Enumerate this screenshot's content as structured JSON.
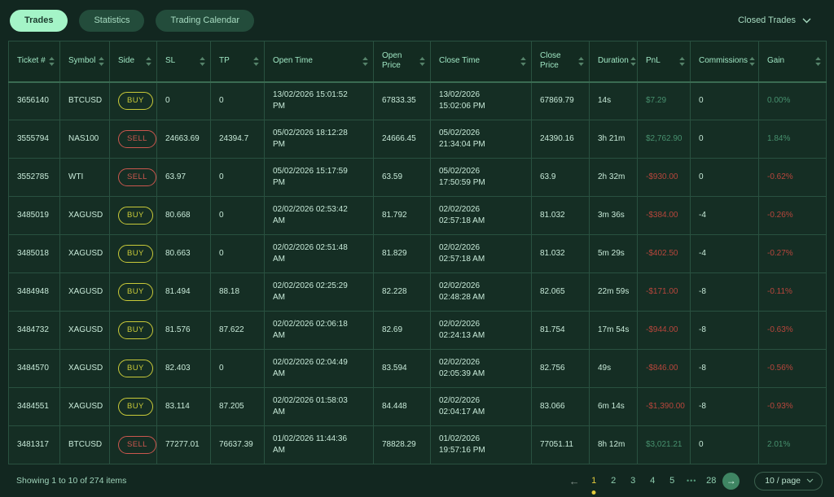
{
  "tabs": [
    {
      "label": "Trades",
      "active": true
    },
    {
      "label": "Statistics",
      "active": false
    },
    {
      "label": "Trading Calendar",
      "active": false
    }
  ],
  "filter": {
    "label": "Closed Trades"
  },
  "table": {
    "columns": [
      {
        "key": "ticket",
        "label": "Ticket #"
      },
      {
        "key": "symbol",
        "label": "Symbol"
      },
      {
        "key": "side",
        "label": "Side"
      },
      {
        "key": "sl",
        "label": "SL"
      },
      {
        "key": "tp",
        "label": "TP"
      },
      {
        "key": "open_time",
        "label": "Open Time"
      },
      {
        "key": "open_price",
        "label": "Open Price"
      },
      {
        "key": "close_time",
        "label": "Close Time"
      },
      {
        "key": "close_price",
        "label": "Close Price"
      },
      {
        "key": "duration",
        "label": "Duration"
      },
      {
        "key": "pnl",
        "label": "PnL"
      },
      {
        "key": "commissions",
        "label": "Commissions"
      },
      {
        "key": "gain",
        "label": "Gain"
      }
    ],
    "rows": [
      {
        "ticket": "3656140",
        "symbol": "BTCUSD",
        "side": "BUY",
        "sl": "0",
        "tp": "0",
        "open_time": "13/02/2026 15:01:52 PM",
        "open_price": "67833.35",
        "close_time": "13/02/2026 15:02:06 PM",
        "close_price": "67869.79",
        "duration": "14s",
        "pnl": "$7.29",
        "commissions": "0",
        "gain": "0.00%"
      },
      {
        "ticket": "3555794",
        "symbol": "NAS100",
        "side": "SELL",
        "sl": "24663.69",
        "tp": "24394.7",
        "open_time": "05/02/2026 18:12:28 PM",
        "open_price": "24666.45",
        "close_time": "05/02/2026 21:34:04 PM",
        "close_price": "24390.16",
        "duration": "3h 21m",
        "pnl": "$2,762.90",
        "commissions": "0",
        "gain": "1.84%"
      },
      {
        "ticket": "3552785",
        "symbol": "WTI",
        "side": "SELL",
        "sl": "63.97",
        "tp": "0",
        "open_time": "05/02/2026 15:17:59 PM",
        "open_price": "63.59",
        "close_time": "05/02/2026 17:50:59 PM",
        "close_price": "63.9",
        "duration": "2h 32m",
        "pnl": "-$930.00",
        "commissions": "0",
        "gain": "-0.62%"
      },
      {
        "ticket": "3485019",
        "symbol": "XAGUSD",
        "side": "BUY",
        "sl": "80.668",
        "tp": "0",
        "open_time": "02/02/2026 02:53:42 AM",
        "open_price": "81.792",
        "close_time": "02/02/2026 02:57:18 AM",
        "close_price": "81.032",
        "duration": "3m 36s",
        "pnl": "-$384.00",
        "commissions": "-4",
        "gain": "-0.26%"
      },
      {
        "ticket": "3485018",
        "symbol": "XAGUSD",
        "side": "BUY",
        "sl": "80.663",
        "tp": "0",
        "open_time": "02/02/2026 02:51:48 AM",
        "open_price": "81.829",
        "close_time": "02/02/2026 02:57:18 AM",
        "close_price": "81.032",
        "duration": "5m 29s",
        "pnl": "-$402.50",
        "commissions": "-4",
        "gain": "-0.27%"
      },
      {
        "ticket": "3484948",
        "symbol": "XAGUSD",
        "side": "BUY",
        "sl": "81.494",
        "tp": "88.18",
        "open_time": "02/02/2026 02:25:29 AM",
        "open_price": "82.228",
        "close_time": "02/02/2026 02:48:28 AM",
        "close_price": "82.065",
        "duration": "22m 59s",
        "pnl": "-$171.00",
        "commissions": "-8",
        "gain": "-0.11%"
      },
      {
        "ticket": "3484732",
        "symbol": "XAGUSD",
        "side": "BUY",
        "sl": "81.576",
        "tp": "87.622",
        "open_time": "02/02/2026 02:06:18 AM",
        "open_price": "82.69",
        "close_time": "02/02/2026 02:24:13 AM",
        "close_price": "81.754",
        "duration": "17m 54s",
        "pnl": "-$944.00",
        "commissions": "-8",
        "gain": "-0.63%"
      },
      {
        "ticket": "3484570",
        "symbol": "XAGUSD",
        "side": "BUY",
        "sl": "82.403",
        "tp": "0",
        "open_time": "02/02/2026 02:04:49 AM",
        "open_price": "83.594",
        "close_time": "02/02/2026 02:05:39 AM",
        "close_price": "82.756",
        "duration": "49s",
        "pnl": "-$846.00",
        "commissions": "-8",
        "gain": "-0.56%"
      },
      {
        "ticket": "3484551",
        "symbol": "XAGUSD",
        "side": "BUY",
        "sl": "83.114",
        "tp": "87.205",
        "open_time": "02/02/2026 01:58:03 AM",
        "open_price": "84.448",
        "close_time": "02/02/2026 02:04:17 AM",
        "close_price": "83.066",
        "duration": "6m 14s",
        "pnl": "-$1,390.00",
        "commissions": "-8",
        "gain": "-0.93%"
      },
      {
        "ticket": "3481317",
        "symbol": "BTCUSD",
        "side": "SELL",
        "sl": "77277.01",
        "tp": "76637.39",
        "open_time": "01/02/2026 11:44:36 AM",
        "open_price": "78828.29",
        "close_time": "01/02/2026 19:57:16 PM",
        "close_price": "77051.11",
        "duration": "8h 12m",
        "pnl": "$3,021.21",
        "commissions": "0",
        "gain": "2.01%"
      }
    ]
  },
  "footer": {
    "summary": "Showing 1 to 10 of 274 items",
    "prev_arrow": "←",
    "next_arrow": "→",
    "pages": [
      "1",
      "2",
      "3",
      "4",
      "5",
      "•••",
      "28"
    ],
    "current_page": "1",
    "page_size": "10 / page"
  },
  "colors": {
    "positive": "#47906e",
    "negative": "#b8463c",
    "buy": "#c9ca39",
    "sell": "#cb574e",
    "active_tab": "#a4f4c7",
    "current_page": "#e2ca3c"
  }
}
